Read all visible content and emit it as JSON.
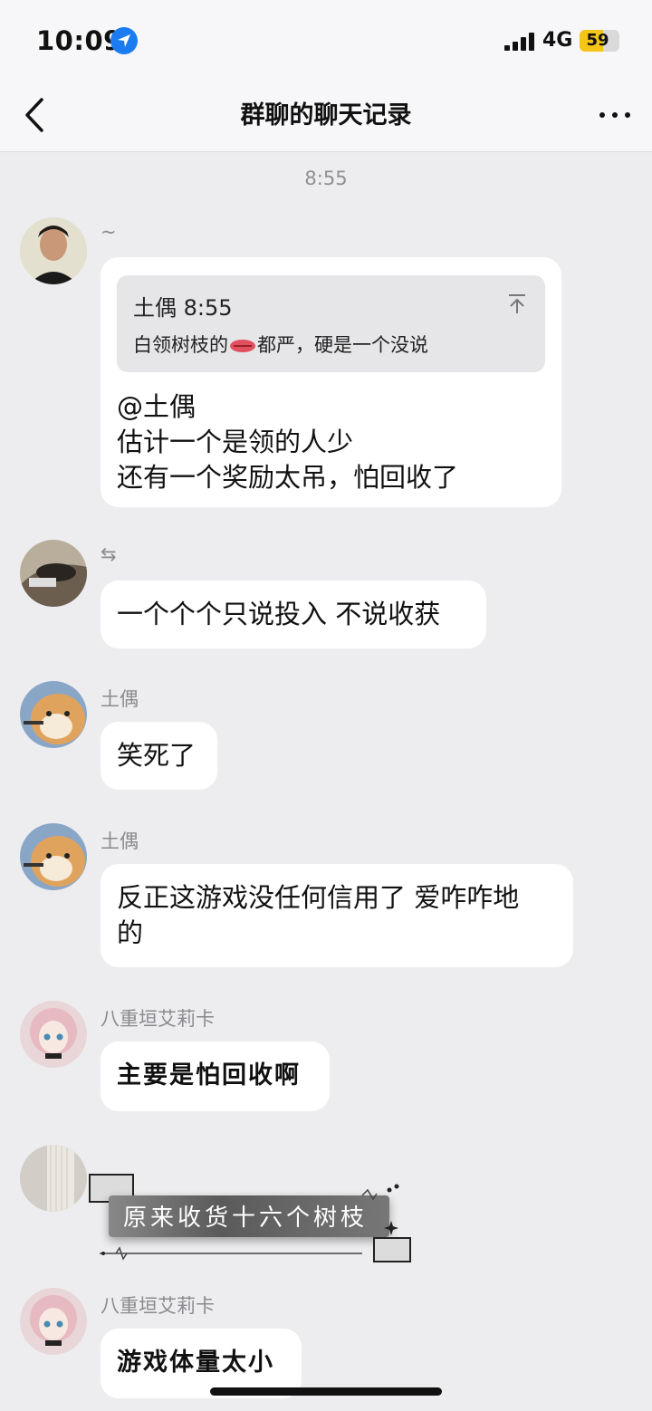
{
  "status_bar": {
    "time": "10:09",
    "network": "4G",
    "battery": "59",
    "battery_level": 0.59
  },
  "nav": {
    "title": "群聊的聊天记录"
  },
  "timestamp": "8:55",
  "messages": [
    {
      "sender": "~",
      "quote": {
        "header": "土偶 8:55",
        "body_before": "白领树枝的",
        "body_after": "都严，硬是一个没说"
      },
      "lines": [
        "@土偶",
        "估计一个是领的人少",
        "还有一个奖励太吊，怕回收了"
      ]
    },
    {
      "sender": "⇆",
      "text": "一个个个只说投入 不说收获"
    },
    {
      "sender": "土偶",
      "text": "笑死了"
    },
    {
      "sender": "土偶",
      "lines": [
        "反正这游戏没任何信用了 爱咋咋地",
        "的"
      ]
    },
    {
      "sender": "八重垣艾莉卡",
      "text": "主要是怕回收啊"
    },
    {
      "sticker_text": "原来收货十六个树枝"
    },
    {
      "sender": "八重垣艾莉卡",
      "text": "游戏体量太小"
    }
  ]
}
